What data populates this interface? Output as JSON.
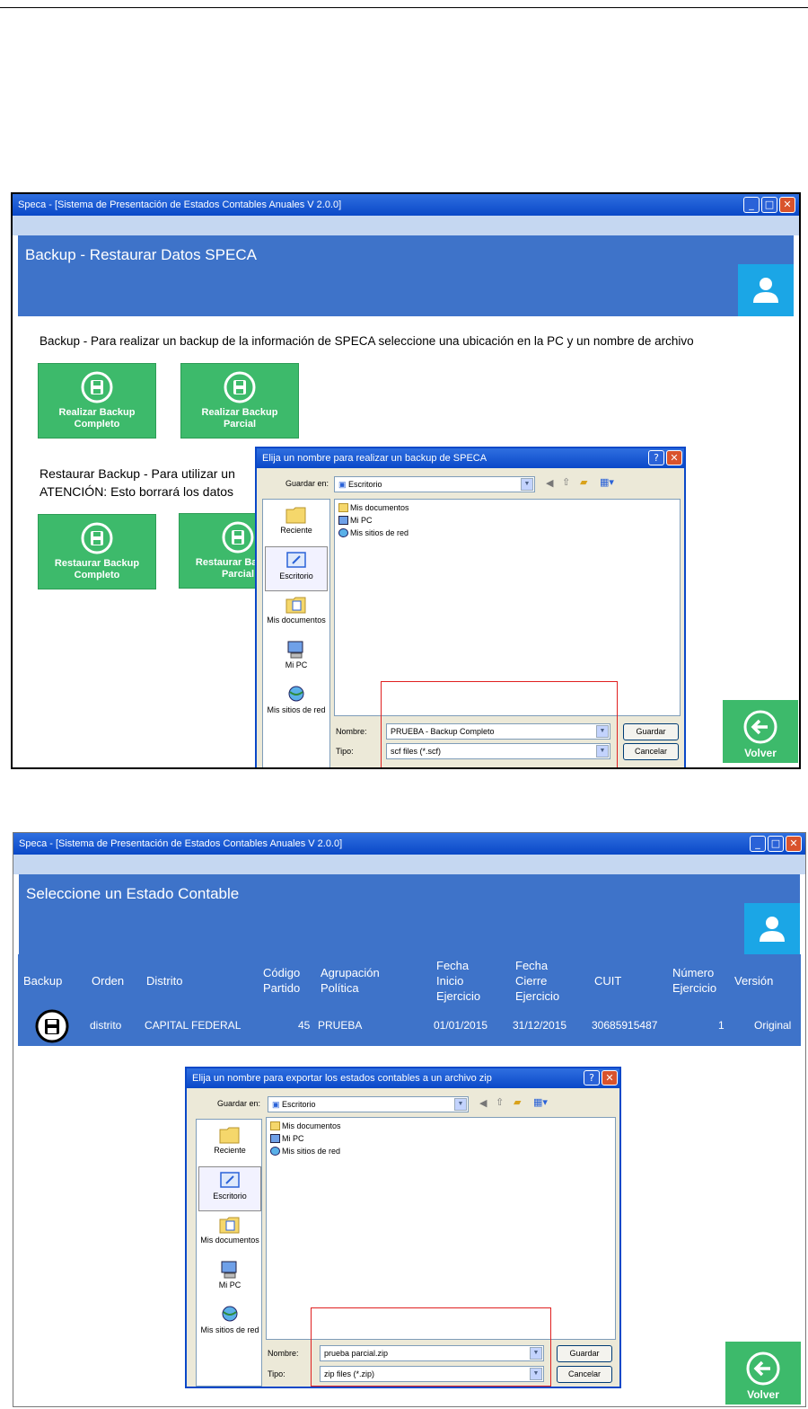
{
  "window1": {
    "title": "Speca - [Sistema de Presentación de Estados Contables Anuales V 2.0.0]",
    "header_title": "Backup - Restaurar Datos SPECA",
    "backup_instruction": "Backup - Para realizar un backup de la información de SPECA seleccione una ubicación en la PC y un nombre de archivo",
    "restore_instruction_line1": "Restaurar Backup - Para utilizar un",
    "restore_instruction_line2": "ATENCIÓN: Esto borrará los datos",
    "buttons": {
      "backup_full": "Realizar Backup Completo",
      "backup_partial": "Realizar Backup Parcial",
      "restore_full": "Restaurar Backup Completo",
      "restore_partial": "Restaurar Backup Parcial"
    },
    "volver": "Volver",
    "dialog": {
      "title": "Elija un nombre para realizar un backup de SPECA",
      "save_in_label": "Guardar en:",
      "save_in_value": "Escritorio",
      "places": [
        "Reciente",
        "Escritorio",
        "Mis documentos",
        "Mi PC",
        "Mis sitios de red"
      ],
      "files": [
        "Mis documentos",
        "Mi PC",
        "Mis sitios de red"
      ],
      "name_label": "Nombre:",
      "name_value": "PRUEBA - Backup Completo",
      "type_label": "Tipo:",
      "type_value": "scf files (*.scf)",
      "save_button": "Guardar",
      "cancel_button": "Cancelar"
    }
  },
  "window2": {
    "title": "Speca - [Sistema de Presentación de Estados Contables Anuales V 2.0.0]",
    "header_title": "Seleccione un Estado Contable",
    "columns": [
      "Backup",
      "Orden",
      "Distrito",
      "Código Partido",
      "Agrupación Política",
      "Fecha Inicio Ejercicio",
      "Fecha Cierre Ejercicio",
      "CUIT",
      "Número Ejercicio",
      "Versión"
    ],
    "row": {
      "orden": "distrito",
      "distrito": "CAPITAL FEDERAL",
      "codigo": "45",
      "agrupacion": "PRUEBA",
      "inicio": "01/01/2015",
      "cierre": "31/12/2015",
      "cuit": "30685915487",
      "numero": "1",
      "version": "Original"
    },
    "volver": "Volver",
    "dialog": {
      "title": "Elija un nombre para exportar los estados contables a un archivo zip",
      "save_in_label": "Guardar en:",
      "save_in_value": "Escritorio",
      "places": [
        "Reciente",
        "Escritorio",
        "Mis documentos",
        "Mi PC",
        "Mis sitios de red"
      ],
      "files": [
        "Mis documentos",
        "Mi PC",
        "Mis sitios de red"
      ],
      "name_label": "Nombre:",
      "name_value": "prueba parcial.zip",
      "type_label": "Tipo:",
      "type_value": "zip files (*.zip)",
      "save_button": "Guardar",
      "cancel_button": "Cancelar"
    }
  },
  "colors": {
    "header_blue": "#3e73c9",
    "green": "#3dba6b",
    "user_blue": "#1ba6e6",
    "highlight_red": "#e02020"
  }
}
